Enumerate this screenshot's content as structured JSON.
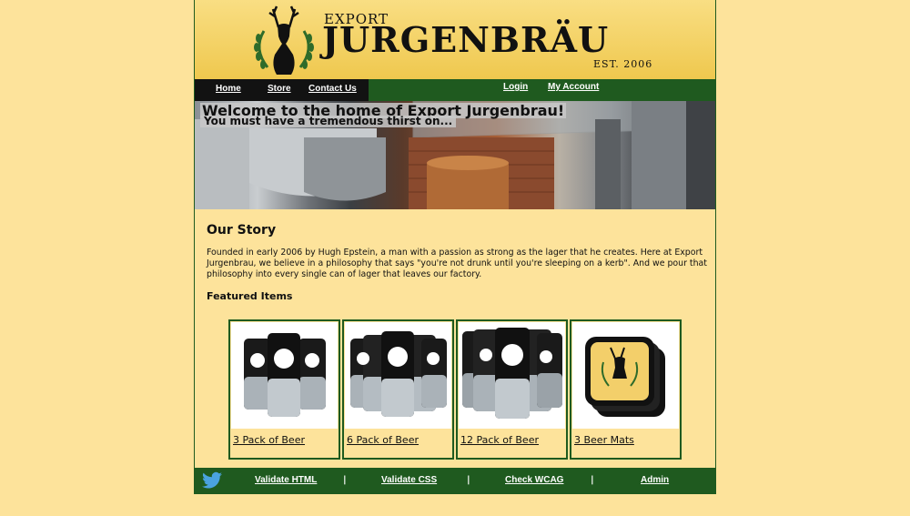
{
  "header": {
    "logo_small": "EXPORT",
    "logo_big": "JURGENBRÄU",
    "logo_est": "EST. 2006"
  },
  "nav": {
    "home": "Home",
    "store": "Store",
    "contact": "Contact Us",
    "login": "Login",
    "account": "My Account"
  },
  "banner": {
    "title": "Welcome to the home of Export Jurgenbrau!",
    "subtitle": "You must have a tremendous thirst on..."
  },
  "story": {
    "title": "Our Story",
    "text": "Founded in early 2006 by Hugh Epstein, a man with a passion as strong as the lager that he creates. Here at Export Jurgenbrau, we believe in a philosophy that says \"you're not drunk until you're sleeping on a kerb\". And we pour that philosophy into every single can of lager that leaves our factory."
  },
  "featured": {
    "title": "Featured Items",
    "items": [
      {
        "label": "3 Pack of Beer"
      },
      {
        "label": "6 Pack of Beer"
      },
      {
        "label": "12 Pack of Beer"
      },
      {
        "label": "3 Beer Mats"
      }
    ]
  },
  "footer": {
    "validate_html": "Validate HTML",
    "validate_css": "Validate CSS",
    "check_wcag": "Check WCAG",
    "admin": "Admin",
    "sep": "|"
  },
  "colors": {
    "background": "#fde39b",
    "green": "#1f5a1f",
    "nav_dark": "#121212"
  },
  "icons": {
    "logo": "stag-wreath-icon",
    "twitter": "twitter-bird-icon"
  }
}
